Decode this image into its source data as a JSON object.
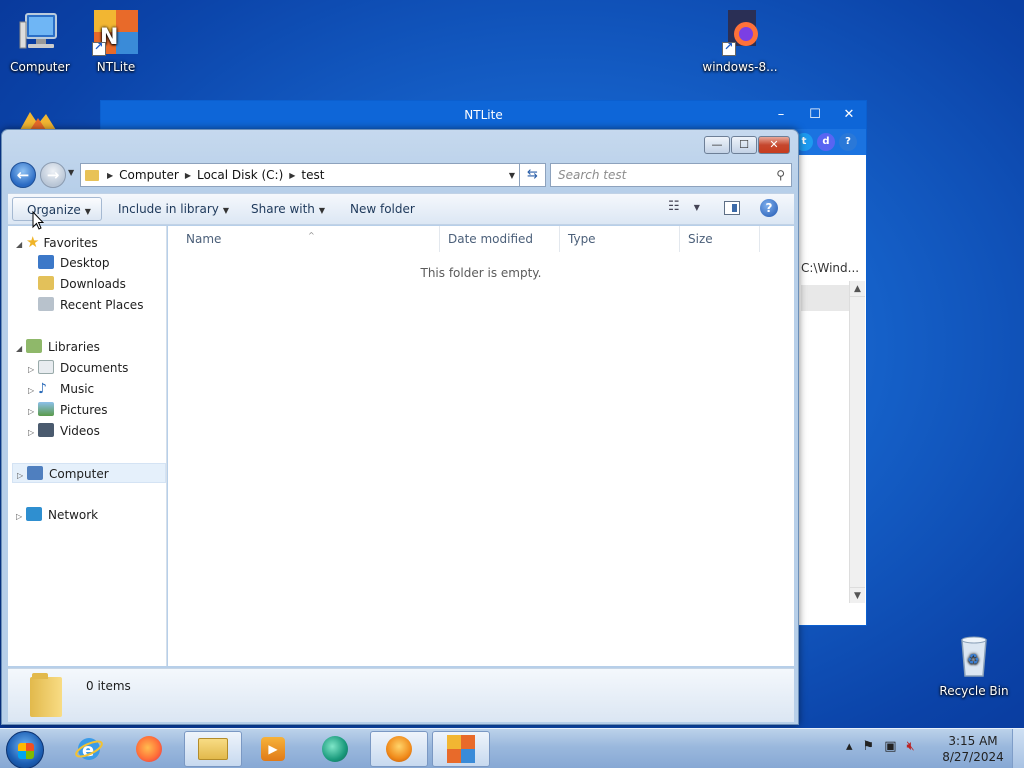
{
  "desktop": {
    "icons": [
      {
        "label": "Computer"
      },
      {
        "label": "NTLite"
      },
      {
        "label": "windows-8..."
      },
      {
        "label": "Recycle Bin"
      }
    ]
  },
  "ntlite_window": {
    "title": "NTLite",
    "controls": {
      "min": "–",
      "max": "☐",
      "close": "✕"
    },
    "path_fragment": "C:\\Wind..."
  },
  "explorer": {
    "window_controls": {
      "min": "—",
      "max": "☐",
      "close": "✕"
    },
    "address": {
      "segments": [
        "Computer",
        "Local Disk (C:)",
        "test"
      ]
    },
    "search": {
      "placeholder": "Search test"
    },
    "toolbar": {
      "organize": "Organize",
      "include_in_library": "Include in library",
      "share_with": "Share with",
      "new_folder": "New folder"
    },
    "nav": {
      "favorites": "Favorites",
      "desktop": "Desktop",
      "downloads": "Downloads",
      "recent_places": "Recent Places",
      "libraries": "Libraries",
      "documents": "Documents",
      "music": "Music",
      "pictures": "Pictures",
      "videos": "Videos",
      "computer": "Computer",
      "network": "Network"
    },
    "columns": {
      "name": "Name",
      "date_modified": "Date modified",
      "type": "Type",
      "size": "Size"
    },
    "empty_message": "This folder is empty.",
    "details": {
      "count": "0 items"
    }
  },
  "taskbar": {
    "clock": {
      "time": "3:15 AM",
      "date": "8/27/2024"
    }
  },
  "colors": {
    "titlebar_blue": "#0e66d8",
    "explorer_frame": "#c6d9ee",
    "close_red": "#c73c1e",
    "taskbar": "#9ab8dd"
  }
}
